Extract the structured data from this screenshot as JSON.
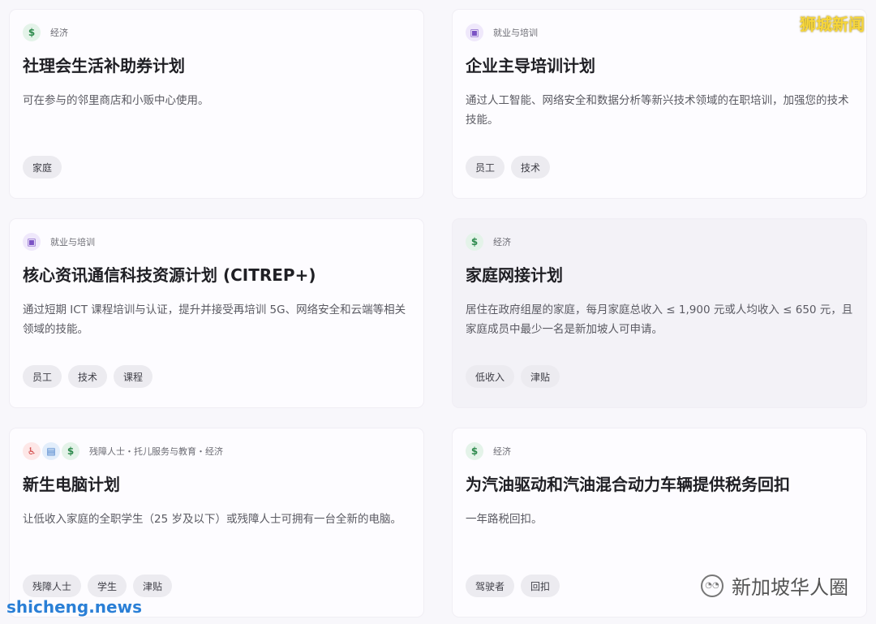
{
  "cards": [
    {
      "category": "经济",
      "title": "社理会生活补助券计划",
      "desc": "可在参与的邻里商店和小贩中心使用。",
      "tags": [
        "家庭"
      ]
    },
    {
      "category": "就业与培训",
      "title": "企业主导培训计划",
      "desc": "通过人工智能、网络安全和数据分析等新兴技术领域的在职培训，加强您的技术技能。",
      "tags": [
        "员工",
        "技术"
      ]
    },
    {
      "category": "就业与培训",
      "title": "核心资讯通信科技资源计划 (CITREP+)",
      "desc": "通过短期 ICT 课程培训与认证，提升并接受再培训 5G、网络安全和云端等相关领域的技能。",
      "tags": [
        "员工",
        "技术",
        "课程"
      ]
    },
    {
      "category": "经济",
      "title": "家庭网接计划",
      "desc": "居住在政府组屋的家庭，每月家庭总收入 ≤ 1,900 元或人均收入 ≤ 650 元，且家庭成员中最少一名是新加坡人可申请。",
      "tags": [
        "低收入",
        "津贴"
      ]
    },
    {
      "category": "残障人士・托儿服务与教育・经济",
      "title": "新生电脑计划",
      "desc": "让低收入家庭的全职学生（25 岁及以下）或残障人士可拥有一台全新的电脑。",
      "tags": [
        "残障人士",
        "学生",
        "津贴"
      ]
    },
    {
      "category": "经济",
      "title": "为汽油驱动和汽油混合动力车辆提供税务回扣",
      "desc": "一年路税回扣。",
      "tags": [
        "驾驶者",
        "回扣"
      ]
    }
  ],
  "watermarks": {
    "top_right": "狮城新闻",
    "bottom_left": "shicheng.news",
    "bottom_right": "新加坡华人圈"
  },
  "icons": {
    "money": "money-bag-icon",
    "bag": "briefcase-icon",
    "wheel": "wheelchair-icon",
    "school": "school-icon"
  }
}
